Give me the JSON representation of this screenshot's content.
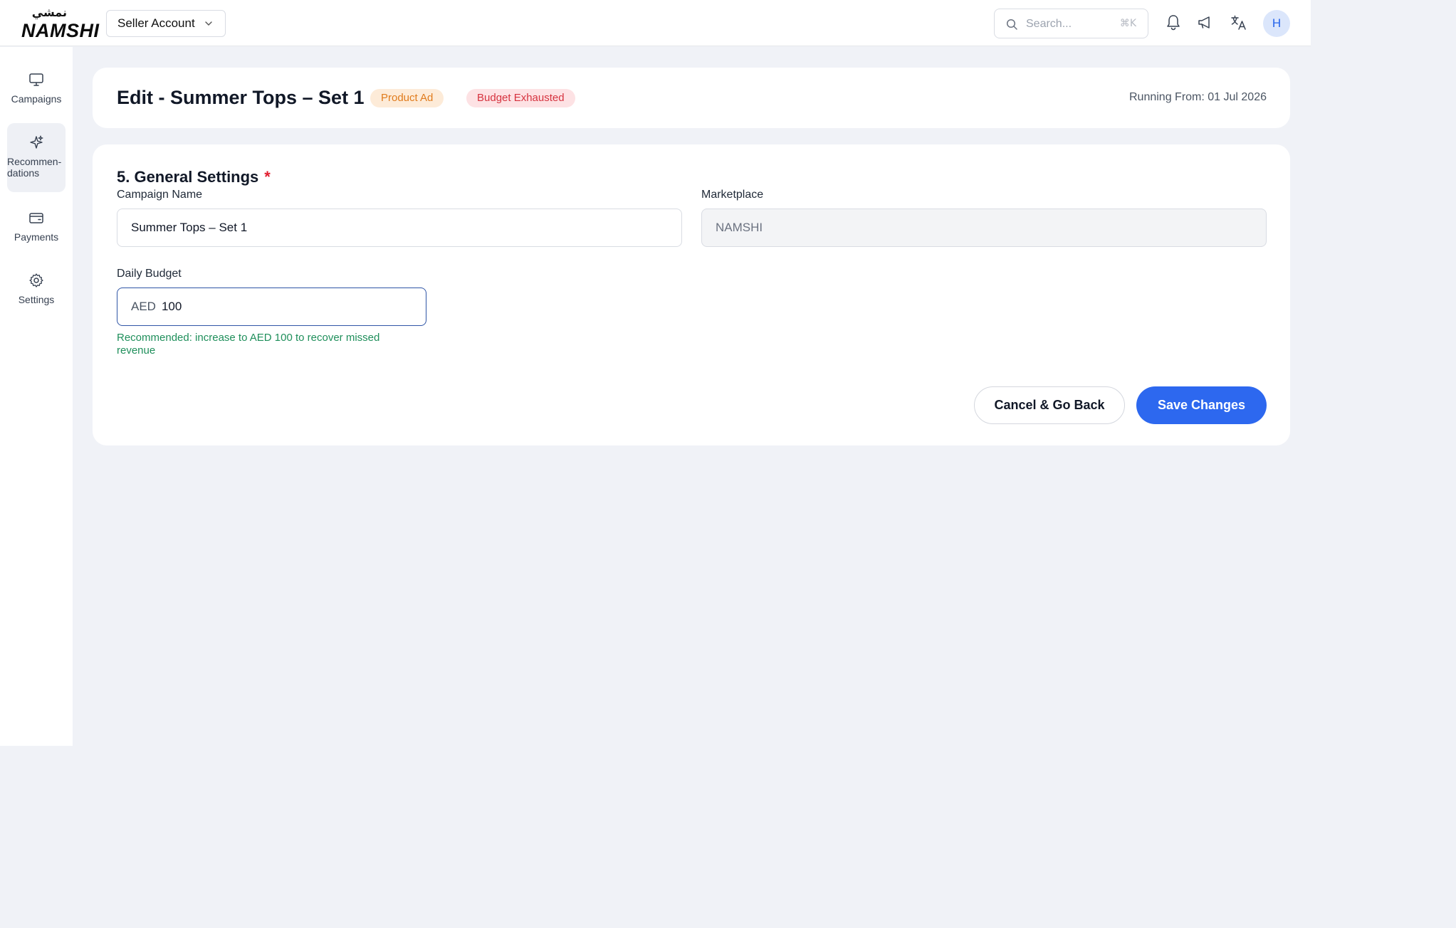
{
  "header": {
    "logo_ar": "نمشي",
    "logo_en": "NAMSHI",
    "account_label": "Seller Account",
    "search_placeholder": "Search...",
    "search_shortcut": "⌘K",
    "avatar_initial": "H"
  },
  "sidebar": {
    "items": [
      {
        "label": "Campaigns",
        "icon": "monitor-icon"
      },
      {
        "label": "Recommen-dations",
        "icon": "sparkle-icon"
      },
      {
        "label": "Payments",
        "icon": "wallet-icon"
      },
      {
        "label": "Settings",
        "icon": "gear-icon"
      }
    ]
  },
  "title_card": {
    "title": "Edit - Summer Tops – Set 1",
    "type_badge": "Product Ad",
    "status_badge": "Budget Exhausted",
    "running_from": "Running From: 01 Jul 2026"
  },
  "settings": {
    "section_title": "5. General Settings",
    "required_mark": "*",
    "campaign_name_label": "Campaign Name",
    "campaign_name_value": "Summer Tops – Set 1",
    "marketplace_label": "Marketplace",
    "marketplace_value": "NAMSHI",
    "daily_budget_label": "Daily Budget",
    "currency": "AED",
    "daily_budget_value": "100",
    "budget_hint": "Recommended: increase to AED 100 to recover missed revenue",
    "cancel_label": "Cancel & Go Back",
    "save_label": "Save Changes"
  },
  "colors": {
    "primary": "#2d68ef",
    "success_hint": "#1f8f5b",
    "danger": "#d6333f",
    "warning": "#e07b1c"
  }
}
